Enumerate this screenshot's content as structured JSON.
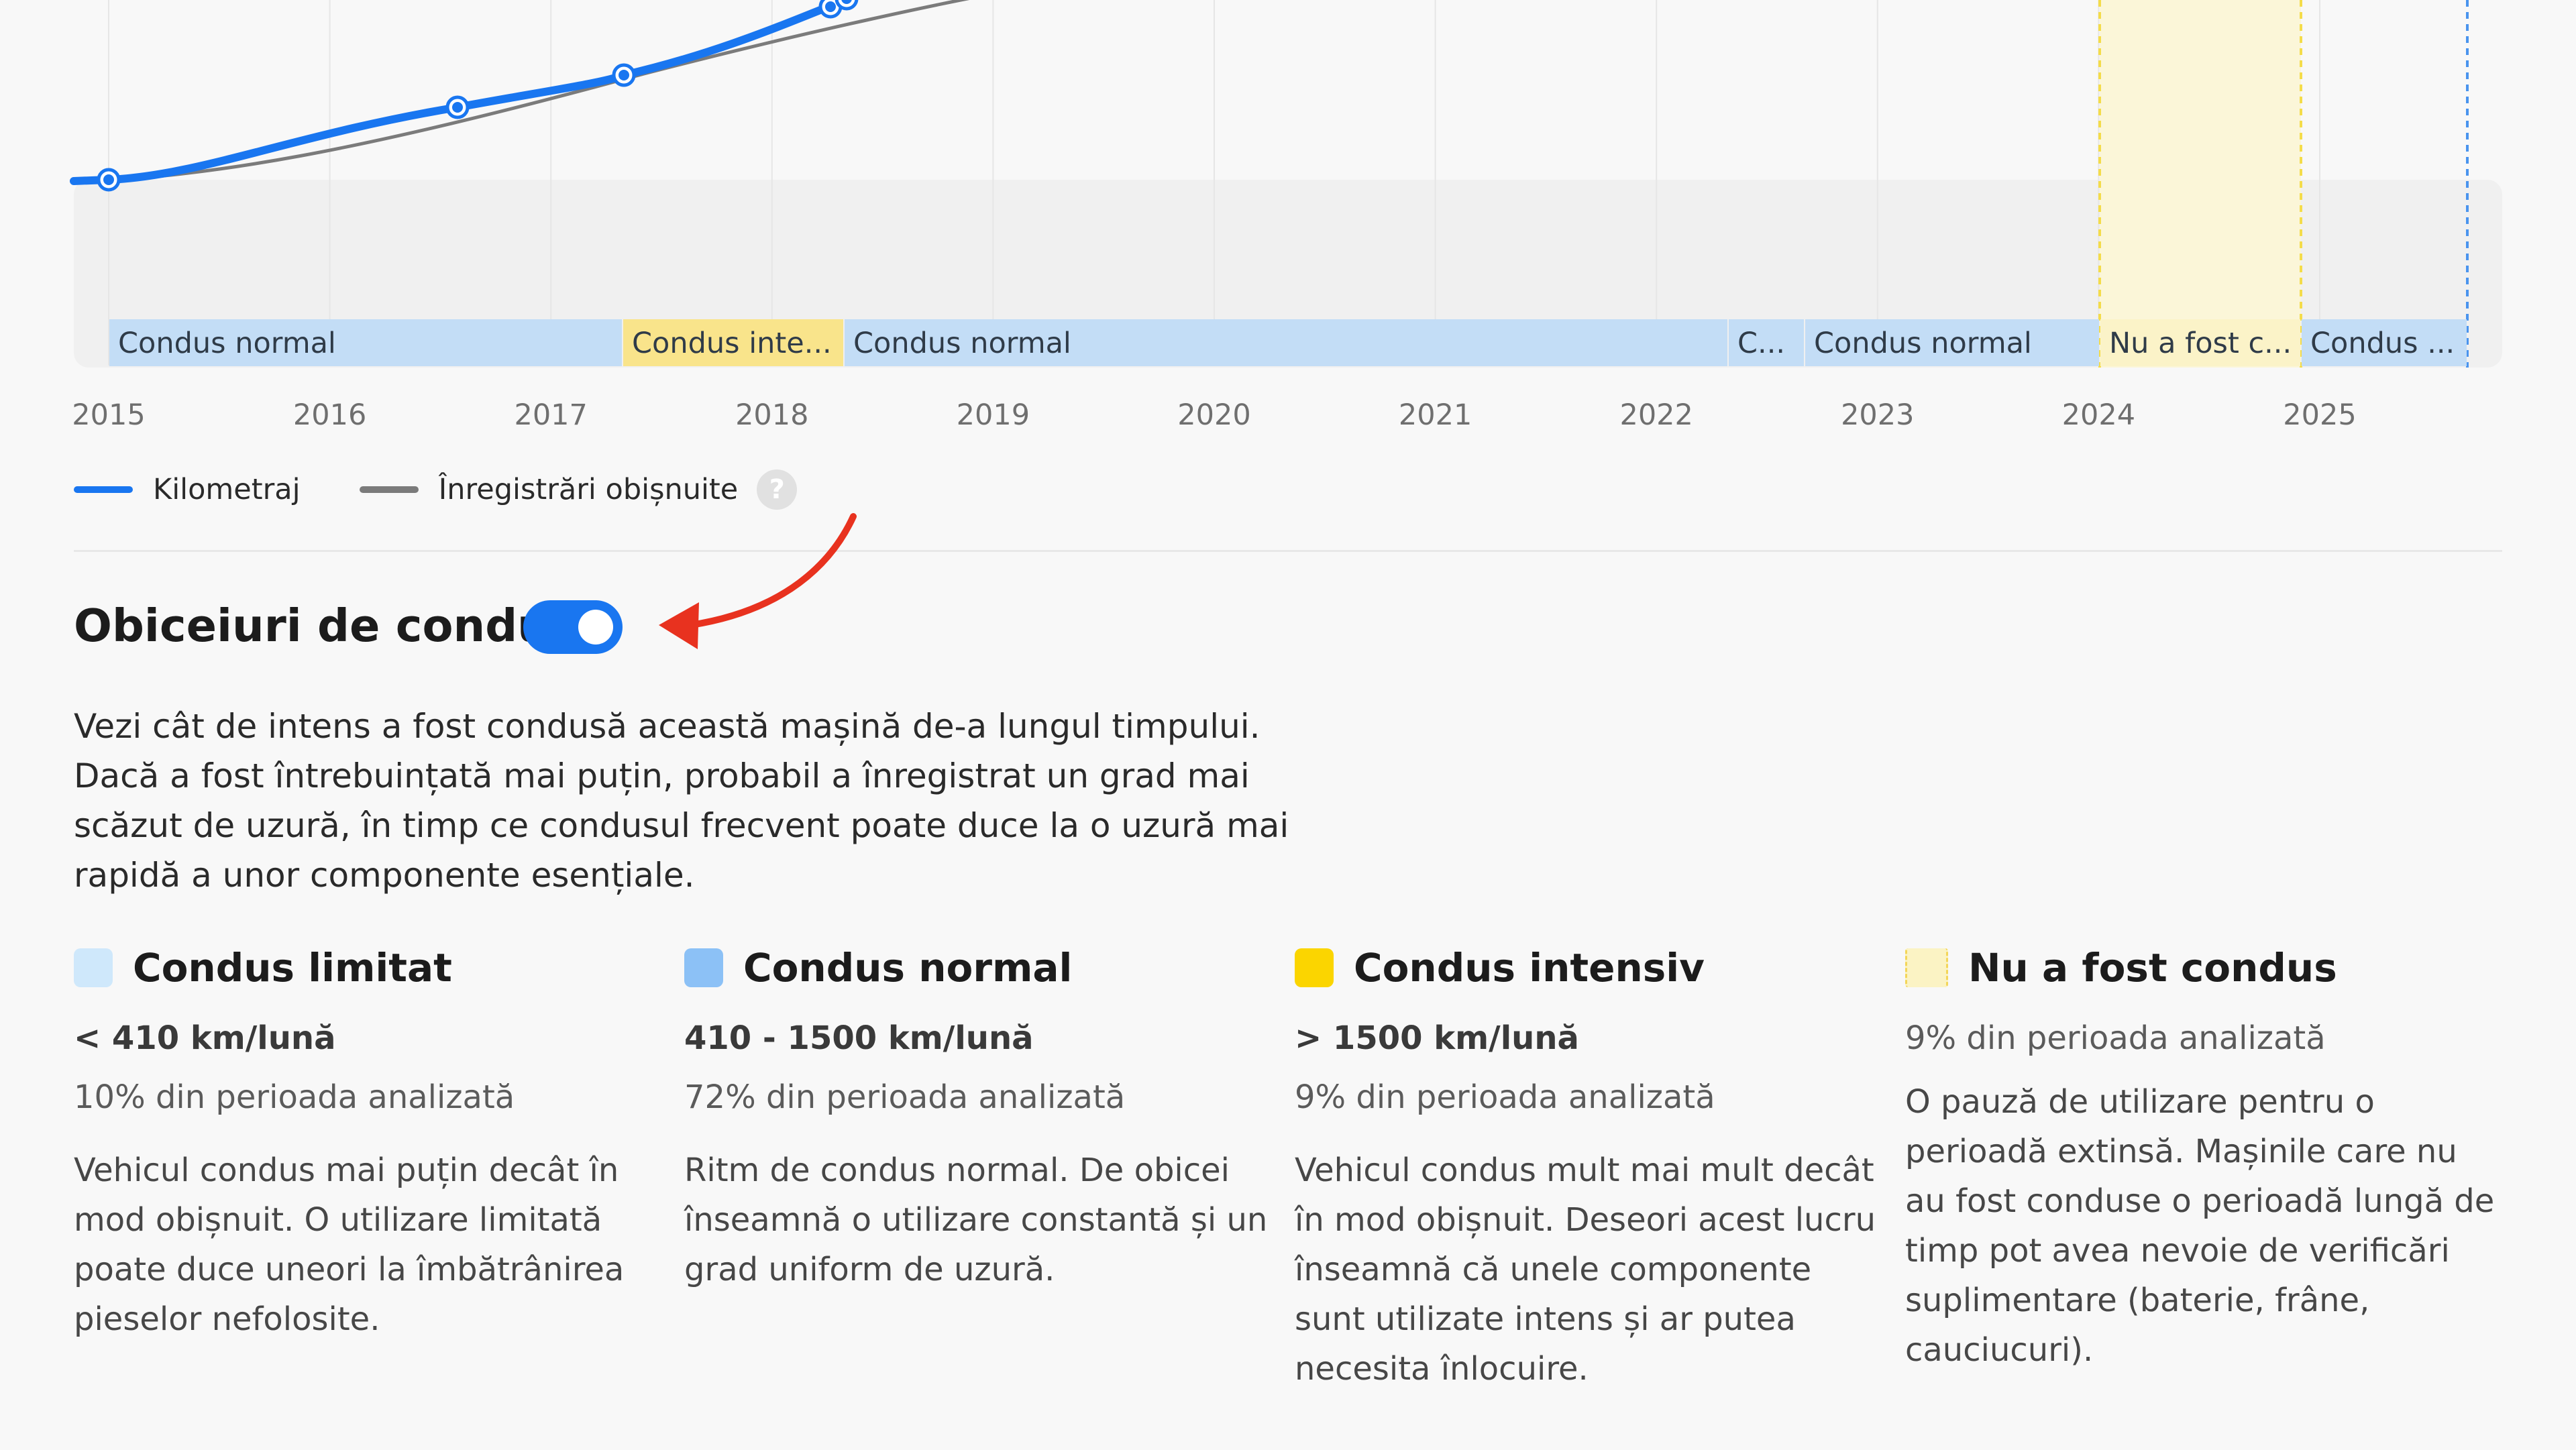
{
  "chart": {
    "years": [
      "2015",
      "2016",
      "2017",
      "2018",
      "2019",
      "2020",
      "2021",
      "2022",
      "2023",
      "2024",
      "2025"
    ],
    "segments": [
      {
        "label": "Condus normal",
        "type": "normal"
      },
      {
        "label": "Condus inte...",
        "type": "intensive"
      },
      {
        "label": "Condus normal",
        "type": "normal"
      },
      {
        "label": "C...",
        "type": "normal"
      },
      {
        "label": "Condus normal",
        "type": "normal"
      },
      {
        "label": "Nu a fost c...",
        "type": "notdriven"
      },
      {
        "label": "Condus ...",
        "type": "normal"
      }
    ]
  },
  "chart_data": {
    "type": "line",
    "series": [
      {
        "name": "Kilometraj",
        "color": "#1976f0"
      },
      {
        "name": "Înregistrări obișnuite",
        "color": "#7b7b7b"
      }
    ]
  },
  "legend": {
    "mileage_label": "Kilometraj",
    "typical_label": "Înregistrări obișnuite",
    "help_glyph": "?"
  },
  "section": {
    "title": "Obiceiuri de condus",
    "toggle_on": true,
    "description": "Vezi cât de intens a fost condusă această mașină de-a lungul timpului. Dacă a fost întrebuințată mai puțin, probabil a înregistrat un grad mai scăzut de uzură, în timp ce condusul frecvent poate duce la o uzură mai rapidă a unor componente esențiale."
  },
  "categories": [
    {
      "title": "Condus limitat",
      "color": "#cfe8fb",
      "range": "< 410 km/lună",
      "share": "10% din perioada analizată",
      "text": "Vehicul condus mai puțin decât în mod obișnuit. O utilizare limitată poate duce uneori la îmbătrânirea pieselor nefolosite."
    },
    {
      "title": "Condus normal",
      "color": "#8cc1f6",
      "range": "410 - 1500 km/lună",
      "share": "72% din perioada analizată",
      "text": "Ritm de condus normal. De obicei înseamnă o utilizare constantă și un grad uniform de uzură."
    },
    {
      "title": "Condus intensiv",
      "color": "#fbd500",
      "range": "> 1500 km/lună",
      "share": "9% din perioada analizată",
      "text": "Vehicul condus mult mai mult decât în mod obișnuit. Deseori acest lucru înseamnă că unele componente sunt utilizate intens și ar putea necesita înlocuire."
    },
    {
      "title": "Nu a fost condus",
      "color": "#fbf3c4",
      "range": "",
      "share": "9% din perioada analizată",
      "text": "O pauză de utilizare pentru o perioadă extinsă. Mașinile care nu au fost conduse o perioadă lungă de timp pot avea nevoie de verificări suplimentare (baterie, frâne, cauciucuri)."
    }
  ]
}
